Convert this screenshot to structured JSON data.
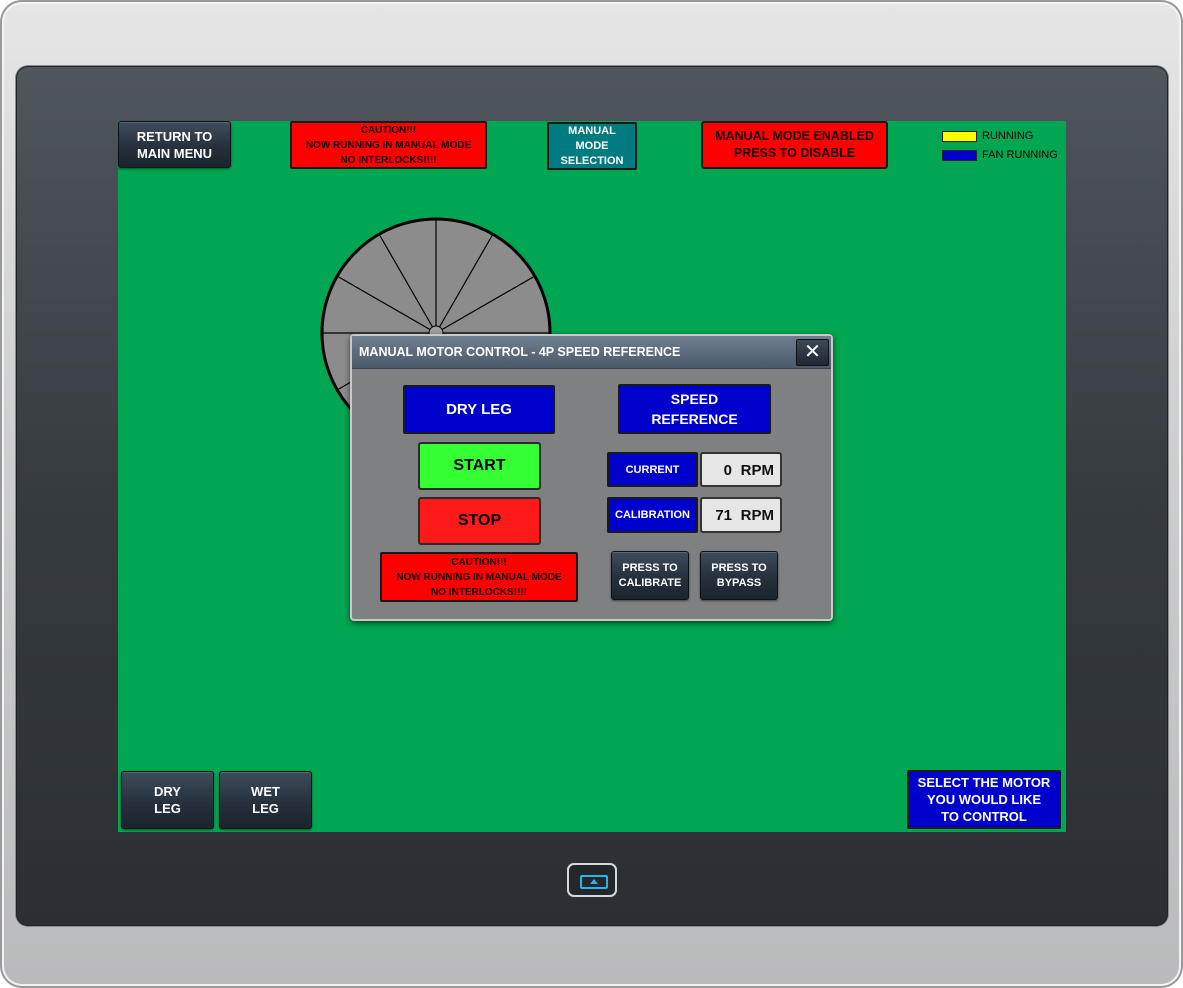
{
  "header": {
    "return_button": {
      "line1": "RETURN TO",
      "line2": "MAIN MENU"
    },
    "caution": {
      "line1": "CAUTION!!!",
      "line2": "NOW RUNNING IN MANUAL MODE",
      "line3": "NO INTERLOCKS!!!!"
    },
    "mode_selection": {
      "line1": "MANUAL",
      "line2": "MODE",
      "line3": "SELECTION"
    },
    "manual_enabled": {
      "line1": "MANUAL MODE ENABLED",
      "line2": "PRESS TO DISABLE"
    }
  },
  "legend": {
    "items": [
      {
        "label": "RUNNING",
        "color": "#ffff00"
      },
      {
        "label": "FAN RUNNING",
        "color": "#0000cc"
      }
    ]
  },
  "dialog": {
    "title": "MANUAL MOTOR CONTROL - 4P SPEED REFERENCE",
    "close_glyph": "✕",
    "motor_label": "DRY LEG",
    "start_label": "START",
    "stop_label": "STOP",
    "caution": {
      "line1": "CAUTION!!!",
      "line2": "NOW RUNNING IN MANUAL MODE",
      "line3": "NO INTERLOCKS!!!!"
    },
    "speed_reference": {
      "line1": "SPEED",
      "line2": "REFERENCE"
    },
    "current": {
      "label": "CURRENT",
      "value": "0",
      "unit": "RPM"
    },
    "calibration": {
      "label": "CALIBRATION",
      "value": "71",
      "unit": "RPM"
    },
    "calibrate_button": {
      "line1": "PRESS TO",
      "line2": "CALIBRATE"
    },
    "bypass_button": {
      "line1": "PRESS TO",
      "line2": "BYPASS"
    }
  },
  "footer": {
    "dry_leg": {
      "line1": "DRY",
      "line2": "LEG"
    },
    "wet_leg": {
      "line1": "WET",
      "line2": "LEG"
    },
    "instruction": {
      "line1": "SELECT THE MOTOR",
      "line2": "YOU WOULD LIKE",
      "line3": "TO CONTROL"
    }
  },
  "colors": {
    "screen_bg": "#00a651",
    "alarm_red": "#ff0000",
    "indicator_blue": "#0000cc",
    "start_green": "#33ff33",
    "mode_teal": "#007b7f"
  }
}
